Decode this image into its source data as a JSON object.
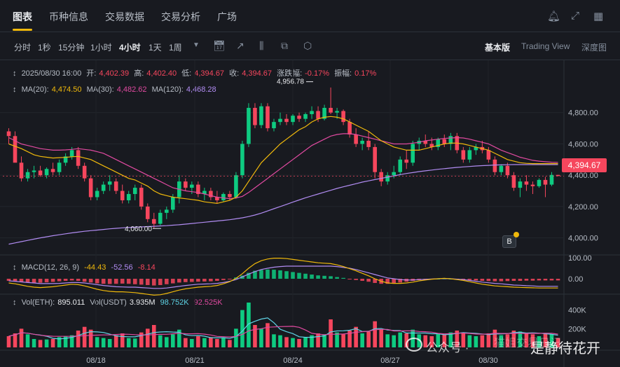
{
  "nav": {
    "tabs": [
      "图表",
      "币种信息",
      "交易数据",
      "交易分析",
      "广场"
    ],
    "active_tab": 0
  },
  "toolbar": {
    "timeframes": [
      "分时",
      "1秒",
      "15分钟",
      "1小时",
      "4小时",
      "1天",
      "1周"
    ],
    "active_timeframe": 4,
    "more_icon": "caret-down-icon",
    "tools": [
      "calendar-icon",
      "indicator-icon",
      "candle-type-icon",
      "template-icon",
      "settings-icon"
    ],
    "views": [
      "基本版",
      "Trading View",
      "深度图"
    ],
    "active_view": 0
  },
  "candle_info": {
    "date": "2025/08/30 16:00",
    "open_label": "开:",
    "open": "4,402.39",
    "high_label": "高:",
    "high": "4,402.40",
    "low_label": "低:",
    "low": "4,394.67",
    "close_label": "收:",
    "close": "4,394.67",
    "change_label": "涨跌幅:",
    "change": "-0.17%",
    "amplitude_label": "振幅:",
    "amplitude": "0.17%"
  },
  "ma_info": {
    "ma20_label": "MA(20):",
    "ma20": "4,474.50",
    "ma30_label": "MA(30):",
    "ma30": "4,482.62",
    "ma120_label": "MA(120):",
    "ma120": "4,468.28"
  },
  "macd_info": {
    "label": "MACD(12, 26, 9)",
    "dif": "-44.43",
    "dea": "-52.56",
    "hist": "-8.14"
  },
  "vol_info": {
    "eth_label": "Vol(ETH):",
    "eth": "895.011",
    "usdt_label": "Vol(USDT)",
    "usdt": "3.935M",
    "ma1": "98.752K",
    "ma2": "92.525K"
  },
  "price_axis": [
    "4,800.00",
    "4,600.00",
    "4,400.00",
    "4,200.00",
    "4,000.00"
  ],
  "price_ticks": [
    4800,
    4600,
    4400,
    4200,
    4000
  ],
  "macd_axis": [
    "100.00",
    "0.00"
  ],
  "vol_axis": [
    "400K",
    "200K"
  ],
  "date_axis": [
    "08/18",
    "08/21",
    "08/24",
    "08/27",
    "08/30"
  ],
  "current_price": "4,394.67",
  "annotations": {
    "high": "4,956.78",
    "low": "4,060.00"
  },
  "watermark": {
    "text1": "公众号 · ",
    "text2": "是静待花开",
    "faint": "猫姐交易日记"
  },
  "colors": {
    "up": "#0ecb81",
    "down": "#f6465d",
    "ma20": "#f0b90b",
    "ma30": "#e04aa0",
    "ma120": "#b18cf2",
    "accent": "#f0b90b"
  },
  "chart_data": {
    "type": "candlestick",
    "symbol": "ETH/USDT",
    "interval": "4h",
    "ylim": [
      3900,
      5000
    ],
    "ohlc": [
      [
        4680,
        4700,
        4600,
        4650
      ],
      [
        4650,
        4680,
        4560,
        4480
      ],
      [
        4480,
        4520,
        4360,
        4380
      ],
      [
        4380,
        4440,
        4360,
        4420
      ],
      [
        4420,
        4460,
        4380,
        4430
      ],
      [
        4430,
        4460,
        4390,
        4400
      ],
      [
        4400,
        4450,
        4380,
        4440
      ],
      [
        4440,
        4480,
        4400,
        4420
      ],
      [
        4420,
        4500,
        4400,
        4480
      ],
      [
        4480,
        4540,
        4460,
        4520
      ],
      [
        4520,
        4580,
        4500,
        4560
      ],
      [
        4560,
        4580,
        4440,
        4460
      ],
      [
        4460,
        4480,
        4360,
        4380
      ],
      [
        4380,
        4400,
        4240,
        4260
      ],
      [
        4260,
        4320,
        4240,
        4300
      ],
      [
        4300,
        4360,
        4280,
        4340
      ],
      [
        4340,
        4400,
        4300,
        4360
      ],
      [
        4360,
        4380,
        4280,
        4300
      ],
      [
        4300,
        4340,
        4220,
        4240
      ],
      [
        4240,
        4300,
        4220,
        4280
      ],
      [
        4280,
        4340,
        4240,
        4320
      ],
      [
        4320,
        4340,
        4180,
        4200
      ],
      [
        4200,
        4220,
        4100,
        4120
      ],
      [
        4120,
        4160,
        4060,
        4090
      ],
      [
        4090,
        4180,
        4080,
        4160
      ],
      [
        4160,
        4200,
        4120,
        4180
      ],
      [
        4180,
        4280,
        4160,
        4260
      ],
      [
        4260,
        4400,
        4220,
        4360
      ],
      [
        4360,
        4380,
        4300,
        4320
      ],
      [
        4320,
        4360,
        4280,
        4340
      ],
      [
        4340,
        4360,
        4260,
        4280
      ],
      [
        4280,
        4320,
        4240,
        4300
      ],
      [
        4300,
        4320,
        4240,
        4260
      ],
      [
        4260,
        4300,
        4220,
        4240
      ],
      [
        4240,
        4290,
        4230,
        4280
      ],
      [
        4280,
        4300,
        4240,
        4260
      ],
      [
        4260,
        4420,
        4250,
        4400
      ],
      [
        4400,
        4620,
        4380,
        4600
      ],
      [
        4600,
        4860,
        4580,
        4830
      ],
      [
        4830,
        4860,
        4700,
        4720
      ],
      [
        4720,
        4860,
        4700,
        4840
      ],
      [
        4840,
        4860,
        4680,
        4700
      ],
      [
        4700,
        4760,
        4680,
        4740
      ],
      [
        4740,
        4800,
        4720,
        4760
      ],
      [
        4760,
        4790,
        4720,
        4740
      ],
      [
        4740,
        4790,
        4720,
        4780
      ],
      [
        4780,
        4800,
        4740,
        4760
      ],
      [
        4760,
        4800,
        4740,
        4790
      ],
      [
        4790,
        4840,
        4760,
        4810
      ],
      [
        4810,
        4840,
        4740,
        4760
      ],
      [
        4760,
        4850,
        4750,
        4830
      ],
      [
        4830,
        4960,
        4790,
        4800
      ],
      [
        4800,
        4830,
        4760,
        4810
      ],
      [
        4810,
        4820,
        4720,
        4740
      ],
      [
        4740,
        4760,
        4640,
        4660
      ],
      [
        4660,
        4700,
        4580,
        4600
      ],
      [
        4600,
        4640,
        4560,
        4620
      ],
      [
        4620,
        4680,
        4560,
        4580
      ],
      [
        4580,
        4600,
        4380,
        4420
      ],
      [
        4420,
        4440,
        4330,
        4360
      ],
      [
        4360,
        4420,
        4340,
        4400
      ],
      [
        4400,
        4460,
        4380,
        4420
      ],
      [
        4420,
        4520,
        4400,
        4500
      ],
      [
        4500,
        4560,
        4440,
        4480
      ],
      [
        4480,
        4620,
        4460,
        4600
      ],
      [
        4600,
        4640,
        4560,
        4620
      ],
      [
        4620,
        4660,
        4580,
        4600
      ],
      [
        4600,
        4640,
        4560,
        4580
      ],
      [
        4580,
        4640,
        4560,
        4630
      ],
      [
        4630,
        4660,
        4580,
        4600
      ],
      [
        4600,
        4670,
        4560,
        4650
      ],
      [
        4650,
        4670,
        4540,
        4560
      ],
      [
        4560,
        4580,
        4480,
        4500
      ],
      [
        4500,
        4580,
        4480,
        4560
      ],
      [
        4560,
        4600,
        4530,
        4580
      ],
      [
        4580,
        4620,
        4540,
        4560
      ],
      [
        4560,
        4580,
        4480,
        4500
      ],
      [
        4500,
        4520,
        4400,
        4420
      ],
      [
        4420,
        4470,
        4400,
        4460
      ],
      [
        4460,
        4480,
        4380,
        4400
      ],
      [
        4400,
        4420,
        4300,
        4320
      ],
      [
        4320,
        4380,
        4260,
        4360
      ],
      [
        4360,
        4400,
        4300,
        4340
      ],
      [
        4340,
        4360,
        4280,
        4330
      ],
      [
        4330,
        4380,
        4320,
        4370
      ],
      [
        4370,
        4390,
        4260,
        4340
      ],
      [
        4340,
        4420,
        4330,
        4402
      ],
      [
        4402,
        4402,
        4394,
        4395
      ]
    ],
    "ma20": [
      4600,
      4585,
      4570,
      4550,
      4530,
      4520,
      4515,
      4510,
      4512,
      4514,
      4518,
      4520,
      4510,
      4500,
      4480,
      4460,
      4440,
      4420,
      4400,
      4380,
      4370,
      4350,
      4330,
      4300,
      4280,
      4270,
      4260,
      4255,
      4250,
      4245,
      4240,
      4230,
      4225,
      4220,
      4230,
      4240,
      4260,
      4300,
      4360,
      4420,
      4480,
      4520,
      4560,
      4600,
      4630,
      4660,
      4690,
      4710,
      4740,
      4760,
      4770,
      4775,
      4770,
      4760,
      4740,
      4720,
      4700,
      4680,
      4650,
      4620,
      4600,
      4580,
      4570,
      4560,
      4560,
      4560,
      4570,
      4580,
      4590,
      4600,
      4605,
      4605,
      4600,
      4590,
      4580,
      4570,
      4560,
      4540,
      4520,
      4500,
      4490,
      4480,
      4476,
      4474,
      4474,
      4474,
      4474,
      4474
    ],
    "ma30": [
      4640,
      4620,
      4600,
      4590,
      4580,
      4570,
      4565,
      4560,
      4560,
      4562,
      4565,
      4570,
      4565,
      4560,
      4550,
      4540,
      4520,
      4500,
      4480,
      4460,
      4440,
      4420,
      4400,
      4380,
      4360,
      4340,
      4320,
      4310,
      4300,
      4295,
      4290,
      4280,
      4270,
      4260,
      4255,
      4250,
      4255,
      4265,
      4290,
      4320,
      4350,
      4380,
      4410,
      4440,
      4470,
      4500,
      4530,
      4560,
      4590,
      4610,
      4630,
      4650,
      4660,
      4665,
      4665,
      4660,
      4650,
      4640,
      4630,
      4620,
      4610,
      4600,
      4600,
      4600,
      4605,
      4610,
      4620,
      4625,
      4630,
      4635,
      4638,
      4640,
      4638,
      4630,
      4620,
      4610,
      4600,
      4580,
      4560,
      4545,
      4530,
      4515,
      4505,
      4495,
      4490,
      4486,
      4483,
      4482
    ],
    "ma120": [
      3960,
      3968,
      3976,
      3984,
      3992,
      4000,
      4007,
      4014,
      4020,
      4026,
      4032,
      4037,
      4042,
      4046,
      4050,
      4054,
      4058,
      4061,
      4064,
      4066,
      4068,
      4070,
      4072,
      4074,
      4076,
      4078,
      4081,
      4084,
      4088,
      4092,
      4096,
      4100,
      4104,
      4108,
      4112,
      4116,
      4122,
      4128,
      4136,
      4146,
      4158,
      4172,
      4186,
      4200,
      4214,
      4228,
      4242,
      4256,
      4268,
      4280,
      4292,
      4304,
      4316,
      4326,
      4336,
      4346,
      4356,
      4364,
      4372,
      4380,
      4388,
      4396,
      4404,
      4411,
      4417,
      4423,
      4428,
      4433,
      4438,
      4442,
      4446,
      4450,
      4453,
      4456,
      4459,
      4461,
      4463,
      4465,
      4466,
      4467,
      4468,
      4468,
      4468,
      4468,
      4468,
      4468,
      4468,
      4468
    ],
    "volume_k": [
      120,
      150,
      200,
      140,
      90,
      80,
      85,
      90,
      110,
      120,
      130,
      180,
      220,
      190,
      110,
      100,
      90,
      130,
      150,
      100,
      95,
      160,
      200,
      240,
      130,
      110,
      140,
      190,
      100,
      90,
      120,
      100,
      110,
      90,
      100,
      80,
      200,
      400,
      480,
      240,
      200,
      260,
      140,
      130,
      110,
      100,
      90,
      110,
      130,
      150,
      140,
      300,
      160,
      140,
      180,
      220,
      150,
      170,
      280,
      190,
      140,
      130,
      160,
      150,
      190,
      140,
      130,
      120,
      150,
      140,
      160,
      180,
      160,
      130,
      120,
      130,
      150,
      190,
      130,
      140,
      180,
      170,
      150,
      140,
      120,
      150,
      140,
      100
    ],
    "macd_hist": [
      -10,
      -12,
      -15,
      -18,
      -20,
      -19,
      -17,
      -15,
      -12,
      -10,
      -8,
      -10,
      -14,
      -18,
      -22,
      -24,
      -25,
      -24,
      -23,
      -24,
      -26,
      -28,
      -30,
      -32,
      -30,
      -26,
      -22,
      -18,
      -16,
      -15,
      -14,
      -13,
      -12,
      -10,
      -6,
      -2,
      6,
      15,
      28,
      38,
      42,
      44,
      43,
      40,
      36,
      32,
      28,
      24,
      20,
      16,
      14,
      12,
      8,
      4,
      -2,
      -6,
      -10,
      -14,
      -20,
      -24,
      -24,
      -22,
      -18,
      -14,
      -10,
      -6,
      -3,
      -1,
      0,
      1,
      0,
      -2,
      -4,
      -6,
      -8,
      -10,
      -11,
      -12,
      -12,
      -11,
      -10,
      -10,
      -9,
      -9,
      -8,
      -8,
      -8,
      -8
    ],
    "macd_dif": [
      -20,
      -24,
      -30,
      -36,
      -40,
      -42,
      -40,
      -38,
      -34,
      -30,
      -26,
      -28,
      -34,
      -42,
      -50,
      -56,
      -60,
      -62,
      -62,
      -64,
      -66,
      -70,
      -74,
      -78,
      -76,
      -70,
      -62,
      -54,
      -48,
      -44,
      -40,
      -38,
      -36,
      -32,
      -24,
      -14,
      2,
      24,
      50,
      72,
      86,
      94,
      98,
      98,
      96,
      92,
      88,
      84,
      80,
      76,
      74,
      72,
      66,
      58,
      48,
      38,
      26,
      14,
      0,
      -12,
      -20,
      -22,
      -22,
      -20,
      -16,
      -10,
      -6,
      -2,
      0,
      2,
      0,
      -4,
      -8,
      -14,
      -20,
      -26,
      -30,
      -34,
      -36,
      -38,
      -40,
      -41,
      -42,
      -43,
      -44,
      -44,
      -44,
      -44
    ],
    "macd_dea": [
      -10,
      -12,
      -15,
      -18,
      -20,
      -23,
      -23,
      -23,
      -22,
      -20,
      -18,
      -18,
      -20,
      -24,
      -28,
      -32,
      -35,
      -38,
      -39,
      -40,
      -40,
      -42,
      -44,
      -46,
      -46,
      -44,
      -40,
      -36,
      -32,
      -29,
      -26,
      -25,
      -24,
      -22,
      -18,
      -12,
      -4,
      9,
      22,
      34,
      44,
      50,
      55,
      58,
      60,
      60,
      60,
      60,
      60,
      60,
      60,
      60,
      58,
      54,
      50,
      44,
      36,
      28,
      20,
      12,
      4,
      0,
      -4,
      -6,
      -6,
      -4,
      -3,
      -1,
      0,
      1,
      0,
      -2,
      -4,
      -8,
      -12,
      -16,
      -19,
      -22,
      -24,
      -27,
      -30,
      -31,
      -33,
      -34,
      -36,
      -36,
      -36,
      -36
    ]
  }
}
